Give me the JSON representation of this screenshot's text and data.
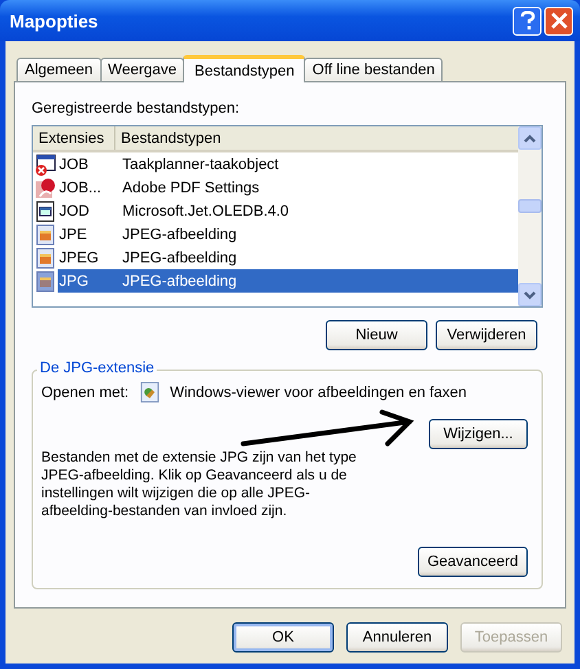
{
  "window": {
    "title": "Mapopties"
  },
  "tabs": [
    {
      "label": "Algemeen",
      "selected": false
    },
    {
      "label": "Weergave",
      "selected": false
    },
    {
      "label": "Bestandstypen",
      "selected": true
    },
    {
      "label": "Off line bestanden",
      "selected": false
    }
  ],
  "registered_label": "Geregistreerde bestandstypen:",
  "list": {
    "columns": [
      "Extensies",
      "Bestandstypen"
    ],
    "rows": [
      {
        "kind": "task",
        "extension": "JOB",
        "type": "Taakplanner-taakobject",
        "selected": false
      },
      {
        "kind": "pdf",
        "extension": "JOB...",
        "type": "Adobe PDF Settings",
        "selected": false
      },
      {
        "kind": "database",
        "extension": "JOD",
        "type": "Microsoft.Jet.OLEDB.4.0",
        "selected": false
      },
      {
        "kind": "image",
        "extension": "JPE",
        "type": "JPEG-afbeelding",
        "selected": false
      },
      {
        "kind": "image",
        "extension": "JPEG",
        "type": "JPEG-afbeelding",
        "selected": false
      },
      {
        "kind": "image",
        "extension": "JPG",
        "type": "JPEG-afbeelding",
        "selected": true
      }
    ]
  },
  "list_buttons": [
    {
      "label": "Nieuw"
    },
    {
      "label": "Verwijderen"
    }
  ],
  "details": {
    "title": "De JPG-extensie",
    "open_with_label": "Openen met:",
    "open_with_app": "Windows-viewer voor afbeeldingen en faxen",
    "change_button": "Wijzigen...",
    "description": "Bestanden met de extensie JPG zijn van het type JPEG-afbeelding. Klik op Geavanceerd als u de instellingen wilt wijzigen die op alle JPEG-afbeelding-bestanden van invloed zijn.",
    "advanced_button": "Geavanceerd"
  },
  "dialog_buttons": [
    {
      "label": "OK",
      "default": true,
      "disabled": false
    },
    {
      "label": "Annuleren",
      "default": false,
      "disabled": false
    },
    {
      "label": "Toepassen",
      "default": false,
      "disabled": true
    }
  ]
}
